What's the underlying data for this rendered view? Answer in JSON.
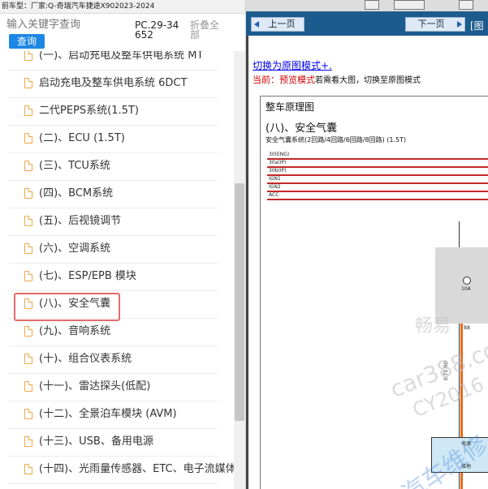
{
  "top_bar": {
    "label": "前车型：厂家:Q-奇瑞汽车捷途X902023-2024"
  },
  "search": {
    "placeholder": "输入关键字查询",
    "button_label": "查询",
    "code": "PC.29-34652",
    "collapse_label": "折叠全部"
  },
  "tree": {
    "items": [
      {
        "label": "(一)、启动充电及整车供电系统 MT"
      },
      {
        "label": "启动充电及整车供电系统 6DCT"
      },
      {
        "label": "二代PEPS系统(1.5T)"
      },
      {
        "label": "(二)、ECU (1.5T)"
      },
      {
        "label": "(三)、TCU系统"
      },
      {
        "label": "(四)、BCM系统"
      },
      {
        "label": "(五)、后视镜调节"
      },
      {
        "label": "(六)、空调系统"
      },
      {
        "label": "(七)、ESP/EPB 模块"
      },
      {
        "label": "(八)、安全气囊"
      },
      {
        "label": "(九)、音响系统"
      },
      {
        "label": "(十)、组合仪表系统"
      },
      {
        "label": "(十一)、雷达探头(低配)"
      },
      {
        "label": "(十二)、全景泊车模块 (AVM)"
      },
      {
        "label": "(十三)、USB、备用电源"
      },
      {
        "label": "(十四)、光雨量传感器、ETC、电子流媒体"
      }
    ],
    "selected": "(八)、安全气囊"
  },
  "viewer": {
    "top_buttons": [
      "",
      "",
      ""
    ],
    "prev_label": "上一页",
    "next_label": "下一页",
    "extra_label": "[图",
    "switch_link": "切换为原图模式+.",
    "mode_prefix": "当前：",
    "mode_name": "预览模式",
    "mode_desc": "若需看大图，切换至原图模式",
    "sheet_title": "整车原理图",
    "section_title": "(八)、安全气囊",
    "section_subtitle": "安全气囊系统(2回路/4回路/6回路/8回路) (1.5T)",
    "bus_labels": [
      "30(ENG)",
      "30a(IP)",
      "30b(IP)",
      "IGN1",
      "IGN2",
      "ACC"
    ],
    "fuse_label": "10A",
    "wire_label": "0.75 RO",
    "node_label": "B8",
    "module_label": "电源",
    "module_sub": "接地"
  },
  "watermarks": [
    "畅易",
    "car388.com",
    "CY2016",
    "汽车维修"
  ],
  "colors": {
    "nav_bar": "#1c5b8e",
    "highlight": "#e36b6b",
    "search_button": "#1d87e4",
    "bus_red": "#c62828",
    "wire_orange": "#e8691a"
  }
}
